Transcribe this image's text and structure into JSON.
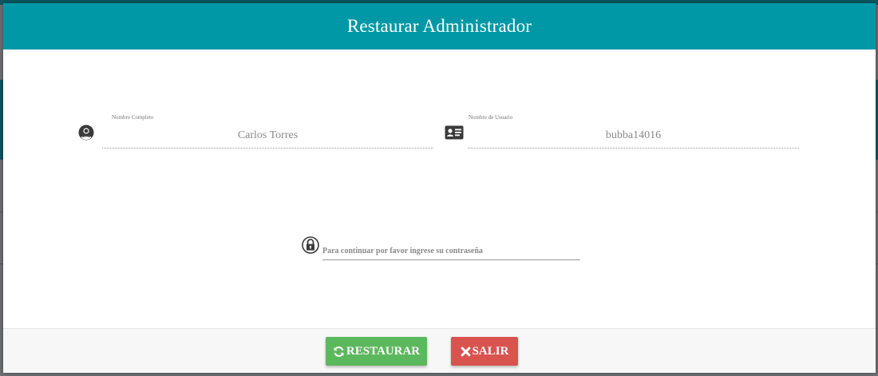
{
  "modal": {
    "title": "Restaurar Administrador"
  },
  "fields": {
    "full_name": {
      "label": "Nombre Completo",
      "value": "Carlos Torres",
      "icon": "user-circle-icon"
    },
    "username": {
      "label": "Nombre de Usuario",
      "value": "bubba14016",
      "icon": "id-card-icon"
    },
    "password": {
      "placeholder": "Para continuar por favor ingrese su contraseña",
      "value": "",
      "icon": "lock-icon"
    }
  },
  "footer": {
    "restore_label": "RESTAURAR",
    "restore_icon": "refresh-icon",
    "exit_label": "SALIR",
    "exit_icon": "close-icon"
  },
  "colors": {
    "header": "#0098a6",
    "restore_button": "#5cb85c",
    "exit_button": "#d9534f"
  }
}
